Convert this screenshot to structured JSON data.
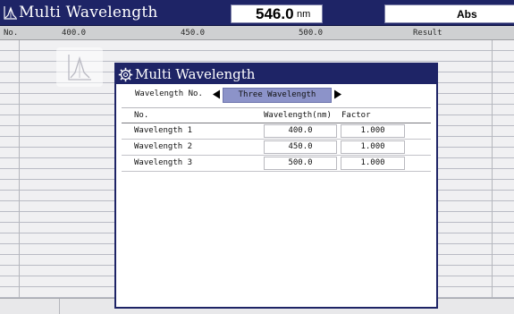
{
  "header": {
    "title": "Multi Wavelength",
    "wavelength_value": "546.0",
    "wavelength_unit": "nm",
    "mode": "Abs"
  },
  "columns": {
    "no": "No.",
    "c1": "400.0",
    "c2": "450.0",
    "c3": "500.0",
    "result": "Result"
  },
  "dialog": {
    "title": "Multi Wavelength",
    "wl_no_label": "Wavelength No.",
    "wl_no_value": "Three Wavelength",
    "table_head": {
      "no": "No.",
      "wavelength": "Wavelength(nm)",
      "factor": "Factor"
    },
    "rows": [
      {
        "name": "Wavelength 1",
        "wavelength": "400.0",
        "factor": "1.000"
      },
      {
        "name": "Wavelength 2",
        "wavelength": "450.0",
        "factor": "1.000"
      },
      {
        "name": "Wavelength 3",
        "wavelength": "500.0",
        "factor": "1.000"
      }
    ]
  },
  "colors": {
    "title_bar": "#1e2466",
    "selection": "#8c93c9",
    "background_grid": "#f0f0f2"
  },
  "icons": [
    "spectrum-icon",
    "gear-icon",
    "arrow-left-icon",
    "arrow-right-icon"
  ]
}
